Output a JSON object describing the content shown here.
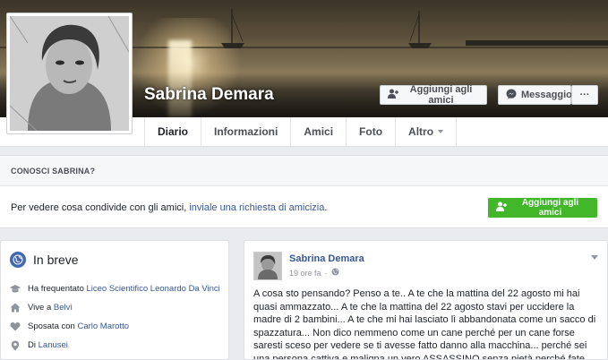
{
  "profile": {
    "name": "Sabrina Demara"
  },
  "actions": {
    "add_friend": "Aggiungi agli amici",
    "message": "Messaggio",
    "more": "···"
  },
  "tabs": [
    {
      "label": "Diario"
    },
    {
      "label": "Informazioni"
    },
    {
      "label": "Amici"
    },
    {
      "label": "Foto"
    },
    {
      "label": "Altro"
    }
  ],
  "know": {
    "header": "CONOSCI SABRINA?",
    "text_before": "Per vedere cosa condivide con gli amici, ",
    "link": "inviale una richiesta di amicizia",
    "text_after": ".",
    "button": "Aggiungi agli amici"
  },
  "intro": {
    "title": "In breve",
    "items": [
      {
        "prefix": "Ha frequentato ",
        "link": "Liceo Scientifico Leonardo Da Vinci",
        "icon": "graduation-cap-icon"
      },
      {
        "prefix": "Vive a ",
        "link": "Belvì",
        "icon": "home-icon"
      },
      {
        "prefix": "Sposata con ",
        "link": "Carlo Marotto",
        "icon": "heart-icon"
      },
      {
        "prefix": "Di ",
        "link": "Lanusei",
        "icon": "location-pin-icon"
      }
    ]
  },
  "post": {
    "author": "Sabrina Demara",
    "time": "19 ore fa",
    "separator": "·",
    "text": "A cosa sto pensando? Penso a te.. A te che la mattina del 22 agosto mi hai quasi ammazzato... A te che la mattina del 22 agosto stavi per uccidere la madre di 2 bambini... A te che mi hai lasciato lì abbandonata come un sacco di spazzatura... Non dico nemmeno come un cane perché per un cane forse saresti sceso per vedere se ti avesse fatto danno alla macchina... perché sei una persona cattiva e maligna un vero ASSASSINO senza pietà perché fate"
  },
  "colors": {
    "link": "#365899",
    "green": "#42b72a",
    "page_bg": "#e9ebee"
  }
}
